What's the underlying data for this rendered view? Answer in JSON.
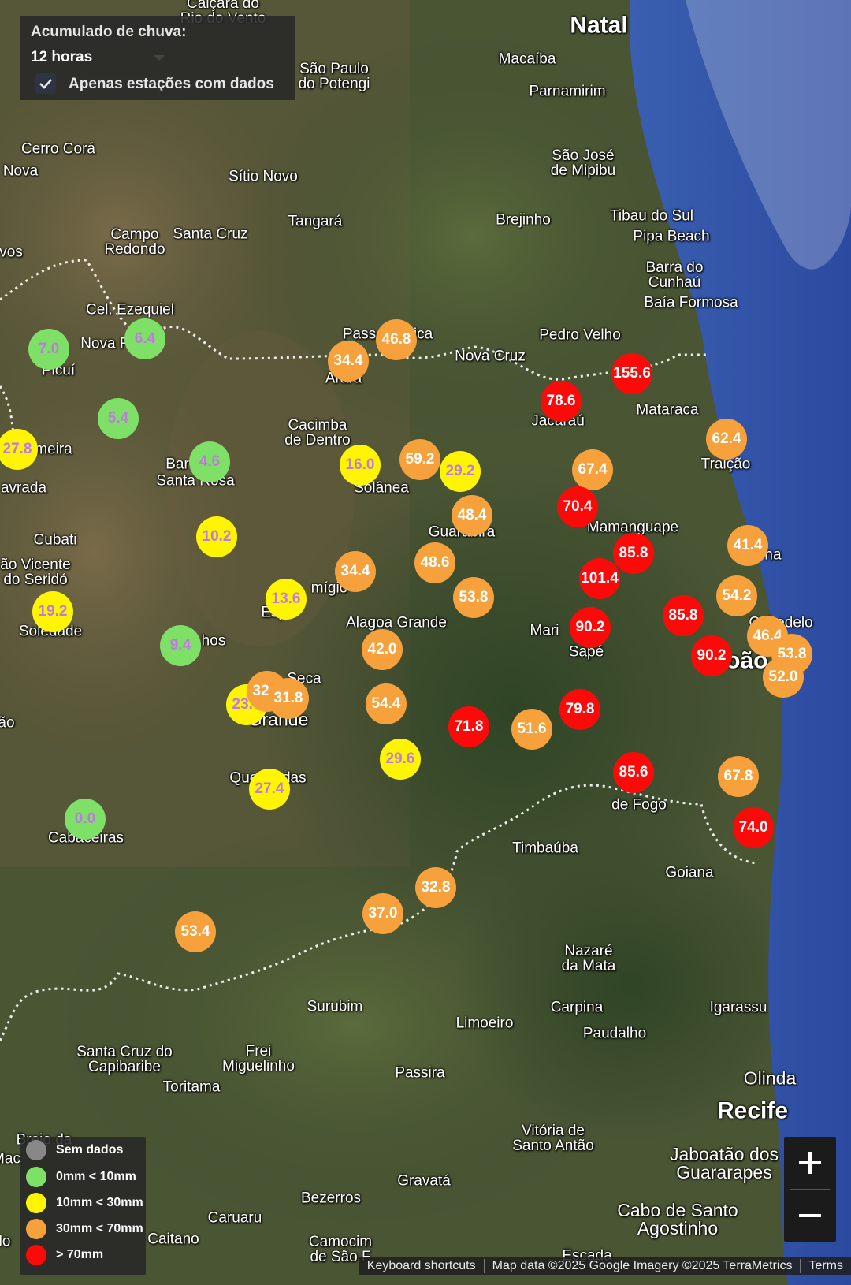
{
  "control": {
    "title": "Acumulado de chuva:",
    "selected": "12 horas",
    "checkbox_checked": true,
    "checkbox_label": "Apenas estações com dados"
  },
  "legend": {
    "items": [
      {
        "label": "Sem dados",
        "color": "#888888"
      },
      {
        "label": "0mm < 10mm",
        "color": "#7ee067"
      },
      {
        "label": "10mm < 30mm",
        "color": "#fff500"
      },
      {
        "label": "30mm < 70mm",
        "color": "#f6a13c"
      },
      {
        "label": "> 70mm",
        "color": "#fc0a0a"
      }
    ]
  },
  "zoom": {
    "in_icon": "plus-icon",
    "out_icon": "minus-icon"
  },
  "attribution": {
    "shortcuts": "Keyboard shortcuts",
    "mapdata": "Map data ©2025 Google Imagery ©2025 TerraMetrics",
    "terms": "Terms"
  },
  "colors": {
    "green": "#7ee067",
    "yellow": "#fff500",
    "orange": "#f6a13c",
    "red": "#fc0a0a"
  },
  "places": [
    "Caiçara do\nRio do Vento",
    "Natal",
    "Macaíba",
    "São Paulo\ndo Potengi",
    "Parnamirim",
    "Cerro Corá",
    "Nova",
    "Sítio Novo",
    "São José\nde Mipibu",
    "Tangará",
    "Brejinho",
    "Tibau do Sul",
    "Pipa Beach",
    "Campo\nRedondo",
    "Santa Cruz",
    "vos",
    "Barra do\nCunhaú",
    "Baía Formosa",
    "Cel. Ezequiel",
    "Nova Fl",
    "Pass",
    "ica",
    "Pedro Velho",
    "Nova Cruz",
    "Picuí",
    "Arara",
    "Jacaraú",
    "Mataraca",
    "Cacimba\nde Dentro",
    "meira",
    "Bar",
    "Santa Rosa",
    "Solânea",
    "Traição",
    "avrada",
    "Guarabira",
    "Mamanguape",
    "Cubati",
    "ão Vicente\ndo Seridó",
    "mígio",
    "Espe",
    "Alagoa Grande",
    "Mari",
    "Sapé",
    "Soledade",
    "hos",
    "Seca",
    "ão",
    "Grande",
    "Queimadas",
    "de Fogo",
    "Timbaúba",
    "Goiana",
    "Cabaceiras",
    "Nazaré\nda Mata",
    "Surubim",
    "Carpina",
    "Igarassu",
    "Limoeiro",
    "Paudalho",
    "Santa Cruz do\nCapibaribe",
    "Frei\nMiguelinho",
    "Passira",
    "Toritama",
    "Olinda",
    "Recife",
    "Vitória de\nSanto Antão",
    "Jaboatão dos\nGuararapes",
    "Gravatá",
    "Brejo da",
    "Mac",
    "Bezerros",
    "Cabo de Santo\nAgostinho",
    "Caruaru",
    "Caitano",
    "Camocim\nde São F",
    "Escada",
    "lo",
    "João Pe",
    "Cabedelo",
    "na"
  ],
  "stations": [
    {
      "value": "7.0",
      "level": "green"
    },
    {
      "value": "6.4",
      "level": "green"
    },
    {
      "value": "5.4",
      "level": "green"
    },
    {
      "value": "4.6",
      "level": "green"
    },
    {
      "value": "9.4",
      "level": "green"
    },
    {
      "value": "0.0",
      "level": "green"
    },
    {
      "value": "27.8",
      "level": "yellow"
    },
    {
      "value": "10.2",
      "level": "yellow"
    },
    {
      "value": "19.2",
      "level": "yellow"
    },
    {
      "value": "13.6",
      "level": "yellow"
    },
    {
      "value": "16.0",
      "level": "yellow"
    },
    {
      "value": "29.2",
      "level": "yellow"
    },
    {
      "value": "23.6",
      "level": "yellow"
    },
    {
      "value": "27.4",
      "level": "yellow"
    },
    {
      "value": "29.6",
      "level": "yellow"
    },
    {
      "value": "46.8",
      "level": "orange"
    },
    {
      "value": "34.4",
      "level": "orange"
    },
    {
      "value": "59.2",
      "level": "orange"
    },
    {
      "value": "67.4",
      "level": "orange"
    },
    {
      "value": "62.4",
      "level": "orange"
    },
    {
      "value": "48.4",
      "level": "orange"
    },
    {
      "value": "34.4",
      "level": "orange"
    },
    {
      "value": "48.6",
      "level": "orange"
    },
    {
      "value": "53.8",
      "level": "orange"
    },
    {
      "value": "41.4",
      "level": "orange"
    },
    {
      "value": "54.2",
      "level": "orange"
    },
    {
      "value": "46.4",
      "level": "orange"
    },
    {
      "value": "53.8",
      "level": "orange"
    },
    {
      "value": "52.0",
      "level": "orange"
    },
    {
      "value": "42.0",
      "level": "orange"
    },
    {
      "value": "32.0",
      "level": "orange"
    },
    {
      "value": "31.8",
      "level": "orange"
    },
    {
      "value": "54.4",
      "level": "orange"
    },
    {
      "value": "51.6",
      "level": "orange"
    },
    {
      "value": "67.8",
      "level": "orange"
    },
    {
      "value": "32.8",
      "level": "orange"
    },
    {
      "value": "37.0",
      "level": "orange"
    },
    {
      "value": "53.4",
      "level": "orange"
    },
    {
      "value": "155.6",
      "level": "red"
    },
    {
      "value": "78.6",
      "level": "red"
    },
    {
      "value": "70.4",
      "level": "red"
    },
    {
      "value": "85.8",
      "level": "red"
    },
    {
      "value": "101.4",
      "level": "red"
    },
    {
      "value": "90.2",
      "level": "red"
    },
    {
      "value": "85.8",
      "level": "red"
    },
    {
      "value": "90.2",
      "level": "red"
    },
    {
      "value": "79.8",
      "level": "red"
    },
    {
      "value": "71.8",
      "level": "red"
    },
    {
      "value": "85.6",
      "level": "red"
    },
    {
      "value": "74.0",
      "level": "red"
    }
  ]
}
